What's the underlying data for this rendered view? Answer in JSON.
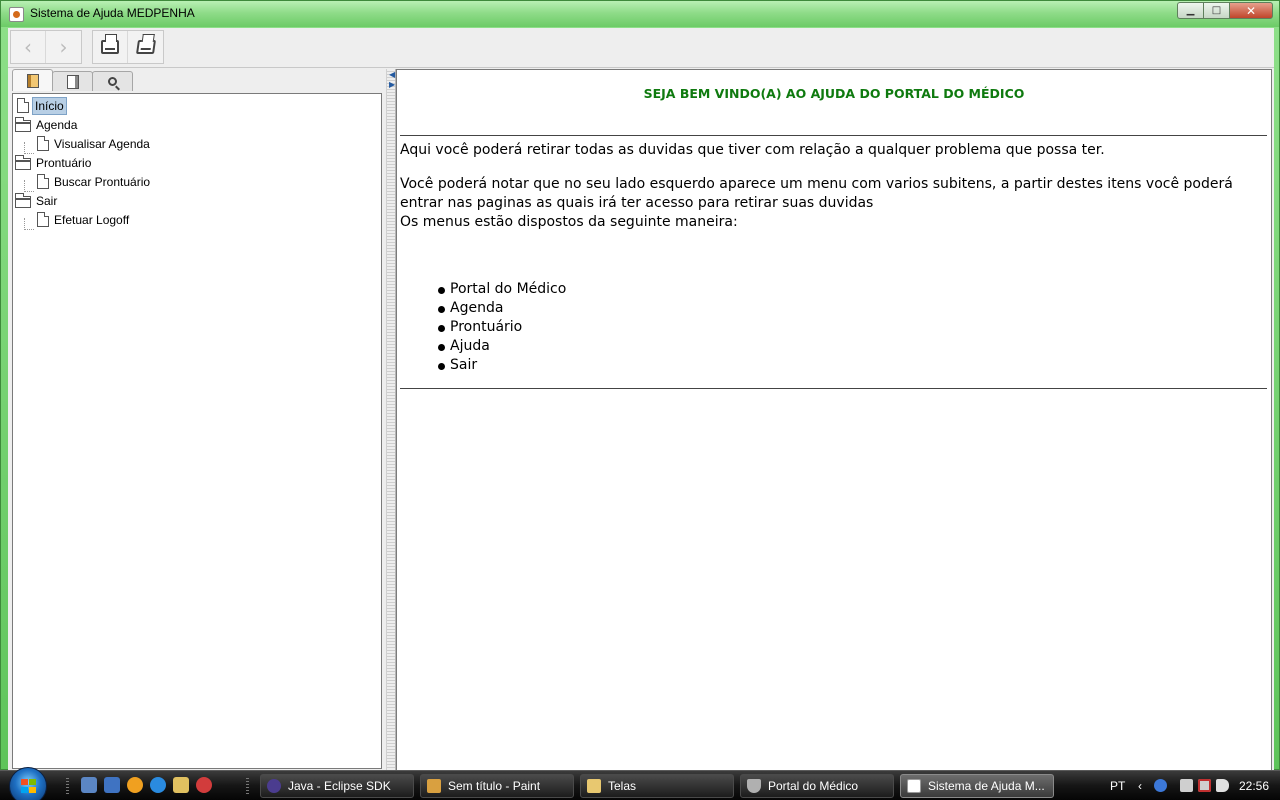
{
  "window": {
    "title": "Sistema de Ajuda MEDPENHA",
    "minimize": "▁",
    "maximize": "□",
    "close": "✕"
  },
  "toolbar": {
    "back": "‹",
    "forward": "›",
    "print_icon": "printer-icon",
    "print_setup_icon": "print-setup-icon"
  },
  "navigator": {
    "tabs": [
      "table-of-contents",
      "index",
      "search"
    ],
    "tree": [
      {
        "label": "Início",
        "type": "page",
        "level": 0,
        "selected": true
      },
      {
        "label": "Agenda",
        "type": "folder",
        "level": 0
      },
      {
        "label": "Visualisar Agenda",
        "type": "page",
        "level": 1
      },
      {
        "label": "Prontuário",
        "type": "folder",
        "level": 0
      },
      {
        "label": "Buscar Prontuário",
        "type": "page",
        "level": 1
      },
      {
        "label": "Sair",
        "type": "folder",
        "level": 0
      },
      {
        "label": "Efetuar Logoff",
        "type": "page",
        "level": 1
      }
    ]
  },
  "content": {
    "heading": "SEJA BEM VINDO(A) AO AJUDA DO PORTAL DO MÉDICO",
    "heading_color": "#0f7a0f",
    "para1": "Aqui você poderá retirar todas as duvidas que tiver com relação a qualquer problema que possa ter.",
    "para2": "Você poderá notar que no seu lado esquerdo aparece um menu com varios subitens, a partir destes itens você poderá entrar nas paginas as quais irá ter acesso para retirar suas duvidas",
    "para3": "Os menus estão dispostos da seguinte maneira:",
    "menu_items": [
      "Portal do Médico",
      "Agenda",
      "Prontuário",
      "Ajuda",
      "Sair"
    ]
  },
  "taskbar": {
    "tasks": [
      {
        "label": "Java - Eclipse SDK",
        "icon": "eclipse-icon",
        "active": false
      },
      {
        "label": "Sem título - Paint",
        "icon": "paint-icon",
        "active": false
      },
      {
        "label": "Telas",
        "icon": "folder-icon",
        "active": false
      },
      {
        "label": "Portal do Médico",
        "icon": "shield-icon",
        "active": false
      },
      {
        "label": "Sistema de Ajuda M...",
        "icon": "java-icon",
        "active": true
      }
    ],
    "language": "PT",
    "clock": "22:56"
  }
}
